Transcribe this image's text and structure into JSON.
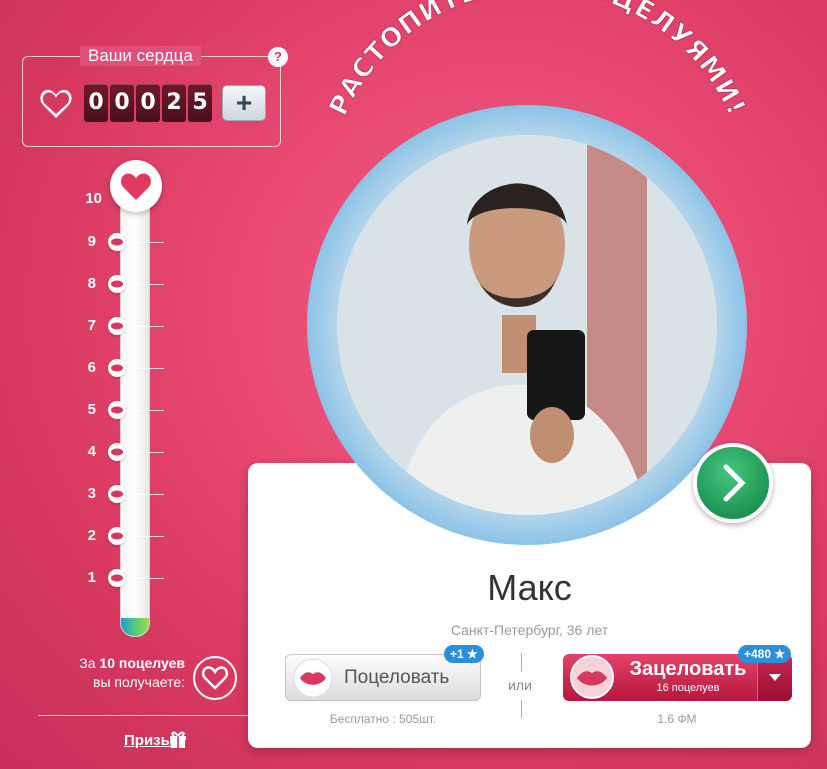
{
  "hearts": {
    "title": "Ваши сердца",
    "help_label": "?",
    "digits": [
      "0",
      "0",
      "0",
      "2",
      "5"
    ],
    "plus_label": "+"
  },
  "scale": {
    "levels": [
      "10",
      "9",
      "8",
      "7",
      "6",
      "5",
      "4",
      "3",
      "2",
      "1"
    ],
    "prize_text_prefix": "За ",
    "prize_text_bold": "10 поцелуев",
    "prize_text_suffix": "вы получаете:",
    "prizes_link": "Призы"
  },
  "headline": "РАСТОПИТЕ ЛЁД ПОЦЕЛУЯМИ!",
  "profile": {
    "name": "Макс",
    "location": "Санкт-Петербург, 36 лет"
  },
  "actions": {
    "kiss_label": "Поцеловать",
    "kiss_badge": "+1",
    "free_text": "Бесплатно : 505шт.",
    "or_text": "или",
    "mass_label": "Зацеловать",
    "mass_sub": "16 поцелуев",
    "mass_badge": "+480",
    "cost_text": "1.6 ФМ"
  },
  "colors": {
    "background": "#e84a73",
    "accent_blue": "#2d8fd8",
    "next_green": "#1f9553",
    "mass_red": "#c92650"
  }
}
